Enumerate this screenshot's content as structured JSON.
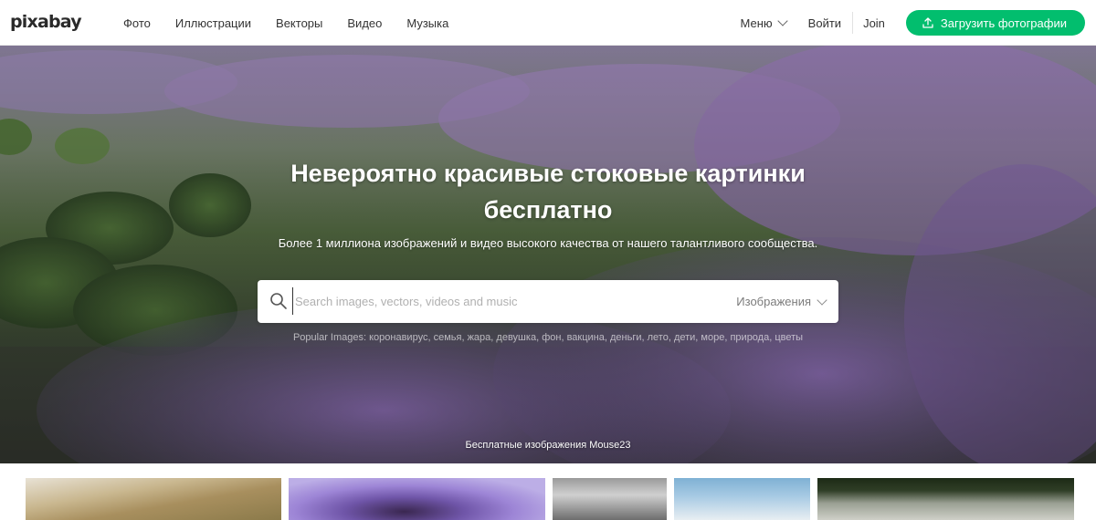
{
  "header": {
    "logo": "pixabay",
    "nav": [
      {
        "label": "Фото"
      },
      {
        "label": "Иллюстрации"
      },
      {
        "label": "Векторы"
      },
      {
        "label": "Видео"
      },
      {
        "label": "Музыка"
      }
    ],
    "menu_label": "Меню",
    "login_label": "Войти",
    "join_label": "Join",
    "upload_label": "Загрузить фотографии",
    "upload_color": "#02be6e"
  },
  "hero": {
    "title_line1": "Невероятно красивые стоковые картинки",
    "title_line2": "бесплатно",
    "subtitle": "Более 1 миллиона изображений и видео высокого качества от нашего талантливого сообщества.",
    "search": {
      "placeholder": "Search images, vectors, videos and music",
      "value": "",
      "type_selected": "Изображения"
    },
    "popular_label": "Popular Images:",
    "popular_terms": [
      "коронавирус",
      "семья",
      "жара",
      "девушка",
      "фон",
      "вакцина",
      "деньги",
      "лето",
      "дети",
      "море",
      "природа",
      "цветы"
    ],
    "credit": "Бесплатные изображения Mouse23"
  },
  "icons": {
    "search": "search-icon",
    "upload": "upload-icon",
    "chevron": "chevron-down-icon"
  }
}
